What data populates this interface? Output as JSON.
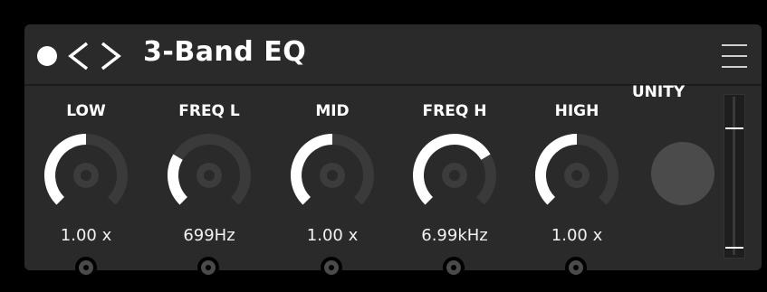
{
  "app": {
    "title": "3-Band EQ"
  },
  "knobs": [
    {
      "label": "LOW",
      "value": "1.00 x",
      "level": 0.5
    },
    {
      "label": "FREQ L",
      "value": "699Hz",
      "level": 0.28
    },
    {
      "label": "MID",
      "value": "1.00 x",
      "level": 0.5
    },
    {
      "label": "FREQ H",
      "value": "6.99kHz",
      "level": 0.72
    },
    {
      "label": "HIGH",
      "value": "1.00 x",
      "level": 0.5
    }
  ],
  "unity": {
    "label": "UNITY"
  },
  "icons": {
    "power": "power-dot-icon",
    "prev": "chevron-left-icon",
    "next": "chevron-right-icon",
    "menu": "hamburger-menu-icon"
  },
  "colors": {
    "background": "#000000",
    "panel": "#2a2a2a",
    "arc_active": "#ffffff",
    "arc_inactive": "#3a3a3a",
    "knob_center": "#3c3c3c",
    "unity_button": "#4b4b4b"
  }
}
